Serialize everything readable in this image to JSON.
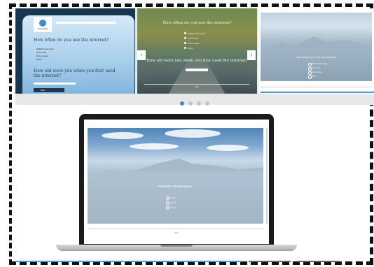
{
  "slides": [
    {
      "question1": "How often do you use the internet?",
      "options": [
        "Multiple times a day",
        "Once a day",
        "Once a week",
        "Never"
      ],
      "question2": "How old were you when you first used the internet?",
      "button_label": "Next",
      "logo_text": "SurveyApp"
    },
    {
      "question1": "How often do you use the internet?",
      "options": [
        "Multiple times a day",
        "Once a day",
        "Once a week",
        "Never"
      ],
      "question2": "How old were you when you first used the internet?",
      "footer": "Next"
    },
    {
      "question": "HOW OFTEN DO YOU USE THE INTERNET?",
      "options": [
        "Multiple times a day",
        "Once a day",
        "Once a week",
        "Never"
      ]
    }
  ],
  "carousel": {
    "dot_count": 4,
    "active_index": 0,
    "prev_arrow": "‹",
    "next_arrow": "›"
  },
  "laptop_survey": {
    "title": "FIRRSTE SPORGSMAL",
    "options": [
      "Svar 1",
      "Svar 2",
      "Svar 3"
    ],
    "footer": "Next"
  },
  "colors": {
    "accent": "#3b8dd0",
    "frame": "#111111"
  }
}
